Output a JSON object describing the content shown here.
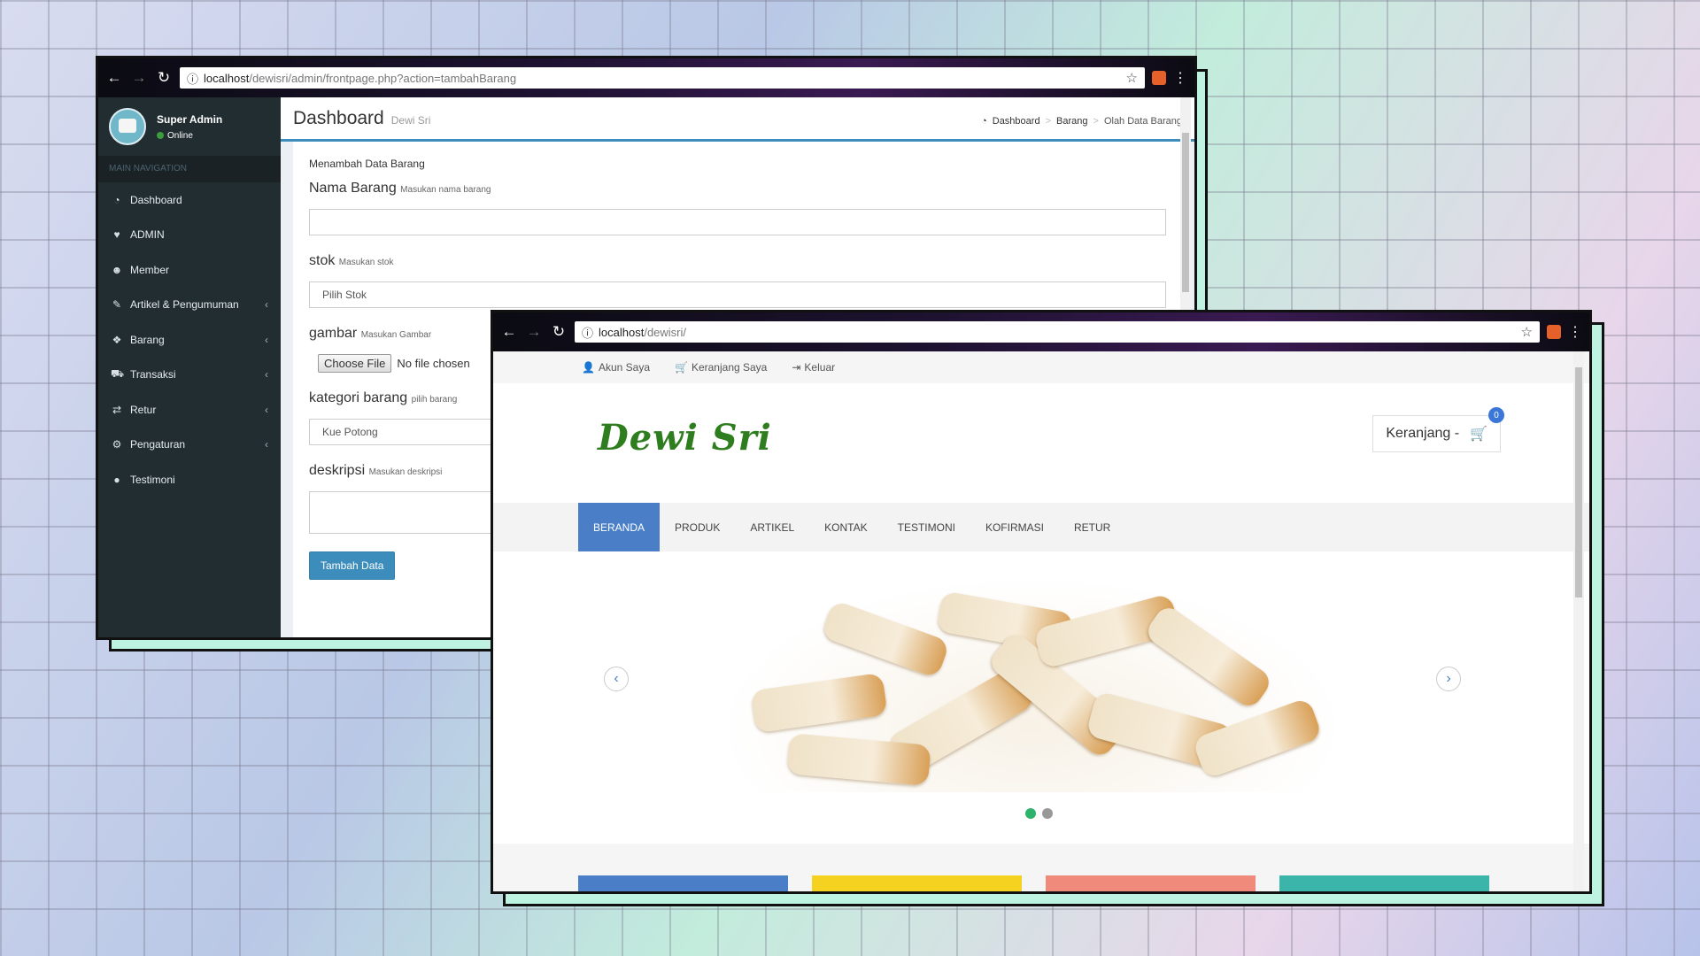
{
  "admin_window": {
    "url_host": "localhost",
    "url_path": "/dewisri/admin/frontpage.php?action=tambahBarang",
    "user": {
      "name": "Super Admin",
      "status": "Online"
    },
    "nav_header": "MAIN NAVIGATION",
    "menu": [
      {
        "label": "Dashboard",
        "icon": "dashboard-icon",
        "glyph": "◔",
        "has_children": false
      },
      {
        "label": "ADMIN",
        "icon": "heart-icon",
        "glyph": "♥",
        "has_children": false
      },
      {
        "label": "Member",
        "icon": "users-icon",
        "glyph": "☻",
        "has_children": false
      },
      {
        "label": "Artikel & Pengumuman",
        "icon": "edit-icon",
        "glyph": "✎",
        "has_children": true
      },
      {
        "label": "Barang",
        "icon": "cubes-icon",
        "glyph": "❖",
        "has_children": true
      },
      {
        "label": "Transaksi",
        "icon": "cart-icon",
        "glyph": "⛟",
        "has_children": true
      },
      {
        "label": "Retur",
        "icon": "exchange-icon",
        "glyph": "⇄",
        "has_children": true
      },
      {
        "label": "Pengaturan",
        "icon": "gear-icon",
        "glyph": "⚙",
        "has_children": true
      },
      {
        "label": "Testimoni",
        "icon": "comment-icon",
        "glyph": "●",
        "has_children": false
      }
    ],
    "chevron": "‹",
    "page_title": "Dashboard",
    "page_subtitle": "Dewi Sri",
    "breadcrumb": [
      "Dashboard",
      "Barang",
      "Olah Data Barang"
    ],
    "breadcrumb_sep": ">",
    "form": {
      "title": "Menambah Data Barang",
      "nama_label": "Nama Barang",
      "nama_hint": "Masukan nama barang",
      "nama_value": "",
      "stok_label": "stok",
      "stok_hint": "Masukan stok",
      "stok_value": "Pilih Stok",
      "gambar_label": "gambar",
      "gambar_hint": "Masukan Gambar",
      "file_button": "Choose File",
      "file_status": "No file chosen",
      "kategori_label": "kategori barang",
      "kategori_hint": "pilih barang",
      "kategori_value": "Kue Potong",
      "deskripsi_label": "deskripsi",
      "deskripsi_hint": "Masukan deskripsi",
      "deskripsi_value": "",
      "submit": "Tambah Data"
    }
  },
  "shop_window": {
    "url_host": "localhost",
    "url_path": "/dewisri/",
    "topbar": [
      {
        "label": "Akun Saya",
        "glyph": "👤"
      },
      {
        "label": "Keranjang Saya",
        "glyph": "🛒"
      },
      {
        "label": "Keluar",
        "glyph": "⇥"
      }
    ],
    "logo": "Dewi Sri",
    "cart_label": "Keranjang -",
    "cart_count": "0",
    "nav": [
      "BERANDA",
      "PRODUK",
      "ARTIKEL",
      "KONTAK",
      "TESTIMONI",
      "KOFIRMASI",
      "RETUR"
    ],
    "active_nav": "BERANDA",
    "slider_prev": "‹",
    "slider_next": "›",
    "indicators": [
      {
        "active": true
      },
      {
        "active": false
      }
    ],
    "card_colors": [
      "#4a7fc8",
      "#f4d21f",
      "#f08a7a",
      "#3bb5a9"
    ]
  },
  "colors": {
    "accent": "#3c8dbc",
    "nav_active": "#4a7fc8",
    "logo": "#2e7d1e",
    "indicator_active": "#2db36b",
    "indicator_inactive": "#999999"
  }
}
